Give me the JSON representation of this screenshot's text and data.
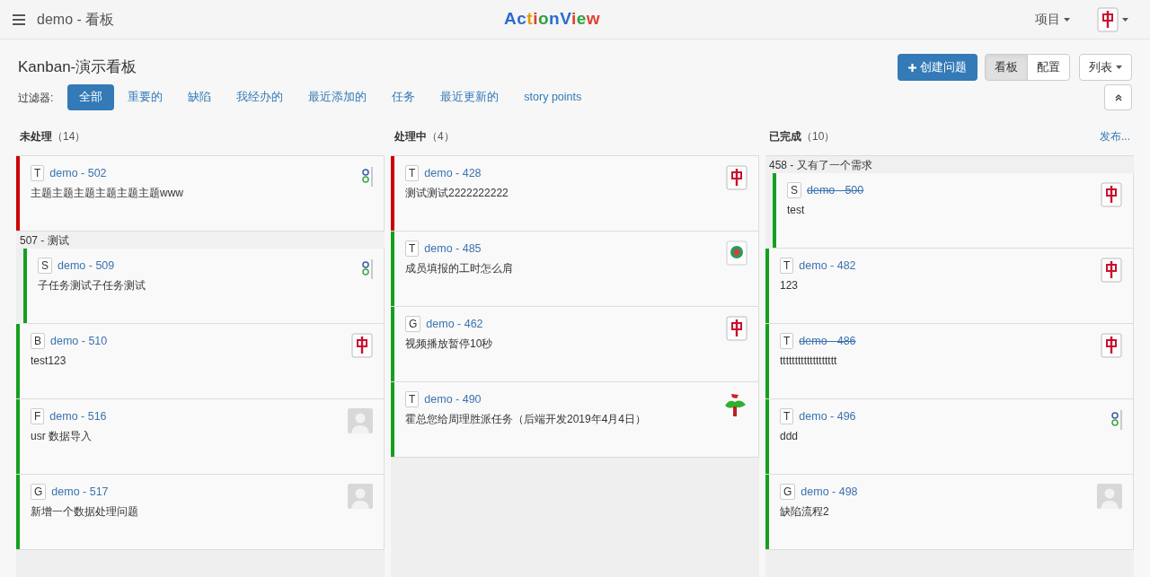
{
  "header": {
    "project": "demo - 看板",
    "logo": "ActionView",
    "menu": "项目"
  },
  "board": {
    "title": "Kanban-演示看板",
    "create_button": "创建问题",
    "views": [
      {
        "label": "看板",
        "selected": true
      },
      {
        "label": "配置",
        "selected": false
      }
    ],
    "list_button": "列表"
  },
  "filter": {
    "label": "过滤器:",
    "items": [
      {
        "label": "全部",
        "selected": true
      },
      {
        "label": "重要的",
        "selected": false
      },
      {
        "label": "缺陷",
        "selected": false
      },
      {
        "label": "我经办的",
        "selected": false
      },
      {
        "label": "最近添加的",
        "selected": false
      },
      {
        "label": "任务",
        "selected": false
      },
      {
        "label": "最近更新的",
        "selected": false
      },
      {
        "label": "story points",
        "selected": false
      }
    ]
  },
  "columns": [
    {
      "title": "未处理",
      "count": "（14）",
      "items": [
        {
          "kind": "card",
          "type": "T",
          "key": "demo - 502",
          "summary": "主题主题主题主题主题主题www",
          "color": "#cc0000",
          "resolved": false,
          "avatar": {
            "kind": "dots"
          }
        },
        {
          "kind": "group",
          "label": "507 - 测试",
          "children": [
            {
              "kind": "card",
              "type": "S",
              "key": "demo - 509",
              "summary": "子任务测试子任务测试",
              "color": "#14a01e",
              "resolved": false,
              "avatar": {
                "kind": "dots"
              }
            }
          ]
        },
        {
          "kind": "card",
          "type": "B",
          "key": "demo - 510",
          "summary": "test123",
          "color": "#14a01e",
          "resolved": false,
          "avatar": {
            "kind": "tile"
          }
        },
        {
          "kind": "card",
          "type": "F",
          "key": "demo - 516",
          "summary": "usr 数据导入",
          "color": "#14a01e",
          "resolved": false,
          "avatar": {
            "kind": "person"
          }
        },
        {
          "kind": "card",
          "type": "G",
          "key": "demo - 517",
          "summary": "新增一个数据处理问题",
          "color": "#14a01e",
          "resolved": false,
          "avatar": {
            "kind": "person"
          }
        }
      ]
    },
    {
      "title": "处理中",
      "count": "（4）",
      "items": [
        {
          "kind": "card",
          "type": "T",
          "key": "demo - 428",
          "summary": "测试测试2222222222",
          "color": "#cc0000",
          "resolved": false,
          "avatar": {
            "kind": "tile"
          }
        },
        {
          "kind": "card",
          "type": "T",
          "key": "demo - 485",
          "summary": "成员填报的工时怎么肩",
          "color": "#14a01e",
          "resolved": false,
          "avatar": {
            "kind": "flower"
          }
        },
        {
          "kind": "card",
          "type": "G",
          "key": "demo - 462",
          "summary": "视频播放暂停10秒",
          "color": "#14a01e",
          "resolved": false,
          "avatar": {
            "kind": "tile"
          }
        },
        {
          "kind": "card",
          "type": "T",
          "key": "demo - 490",
          "summary": "霍总您给周理胜派任务（后端开发2019年4月4日）",
          "color": "#14a01e",
          "resolved": false,
          "avatar": {
            "kind": "figure"
          }
        }
      ]
    },
    {
      "title": "已完成",
      "count": "（10）",
      "action": "发布...",
      "items": [
        {
          "kind": "group",
          "label": "458 - 又有了一个需求",
          "children": [
            {
              "kind": "card",
              "type": "S",
              "key": "demo - 500",
              "summary": "test",
              "color": "#14a01e",
              "resolved": true,
              "avatar": {
                "kind": "tile"
              }
            }
          ]
        },
        {
          "kind": "card",
          "type": "T",
          "key": "demo - 482",
          "summary": "123",
          "color": "#14a01e",
          "resolved": false,
          "avatar": {
            "kind": "tile"
          }
        },
        {
          "kind": "card",
          "type": "T",
          "key": "demo - 486",
          "summary": "ttttttttttttttttttt",
          "color": "#14a01e",
          "resolved": true,
          "avatar": {
            "kind": "tile"
          }
        },
        {
          "kind": "card",
          "type": "T",
          "key": "demo - 496",
          "summary": "ddd",
          "color": "#14a01e",
          "resolved": false,
          "avatar": {
            "kind": "dots"
          }
        },
        {
          "kind": "card",
          "type": "G",
          "key": "demo - 498",
          "summary": "缺陷流程2",
          "color": "#14a01e",
          "resolved": false,
          "avatar": {
            "kind": "person"
          }
        }
      ]
    }
  ]
}
